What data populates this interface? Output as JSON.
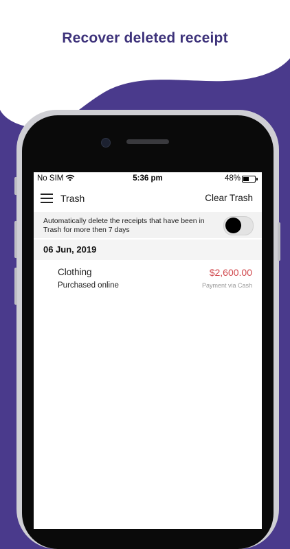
{
  "headline": "Recover deleted receipt",
  "colors": {
    "background": "#4a3a8c",
    "headline": "#3d327a",
    "amount": "#d0474c",
    "toggle_knob": "#000000"
  },
  "status_bar": {
    "carrier": "No SIM",
    "time": "5:36 pm",
    "battery_percent": "48%",
    "wifi_icon": "wifi-icon",
    "battery_level": 0.48
  },
  "nav": {
    "menu_icon": "hamburger-menu-icon",
    "title": "Trash",
    "action": "Clear Trash"
  },
  "auto_delete": {
    "text": "Automatically delete the receipts that have been in Trash for more then 7 days",
    "enabled": false
  },
  "groups": [
    {
      "date": "06 Jun, 2019",
      "items": [
        {
          "name": "Clothing",
          "subtitle": "Purchased online",
          "amount": "$2,600.00",
          "payment": "Payment via Cash"
        }
      ]
    }
  ]
}
